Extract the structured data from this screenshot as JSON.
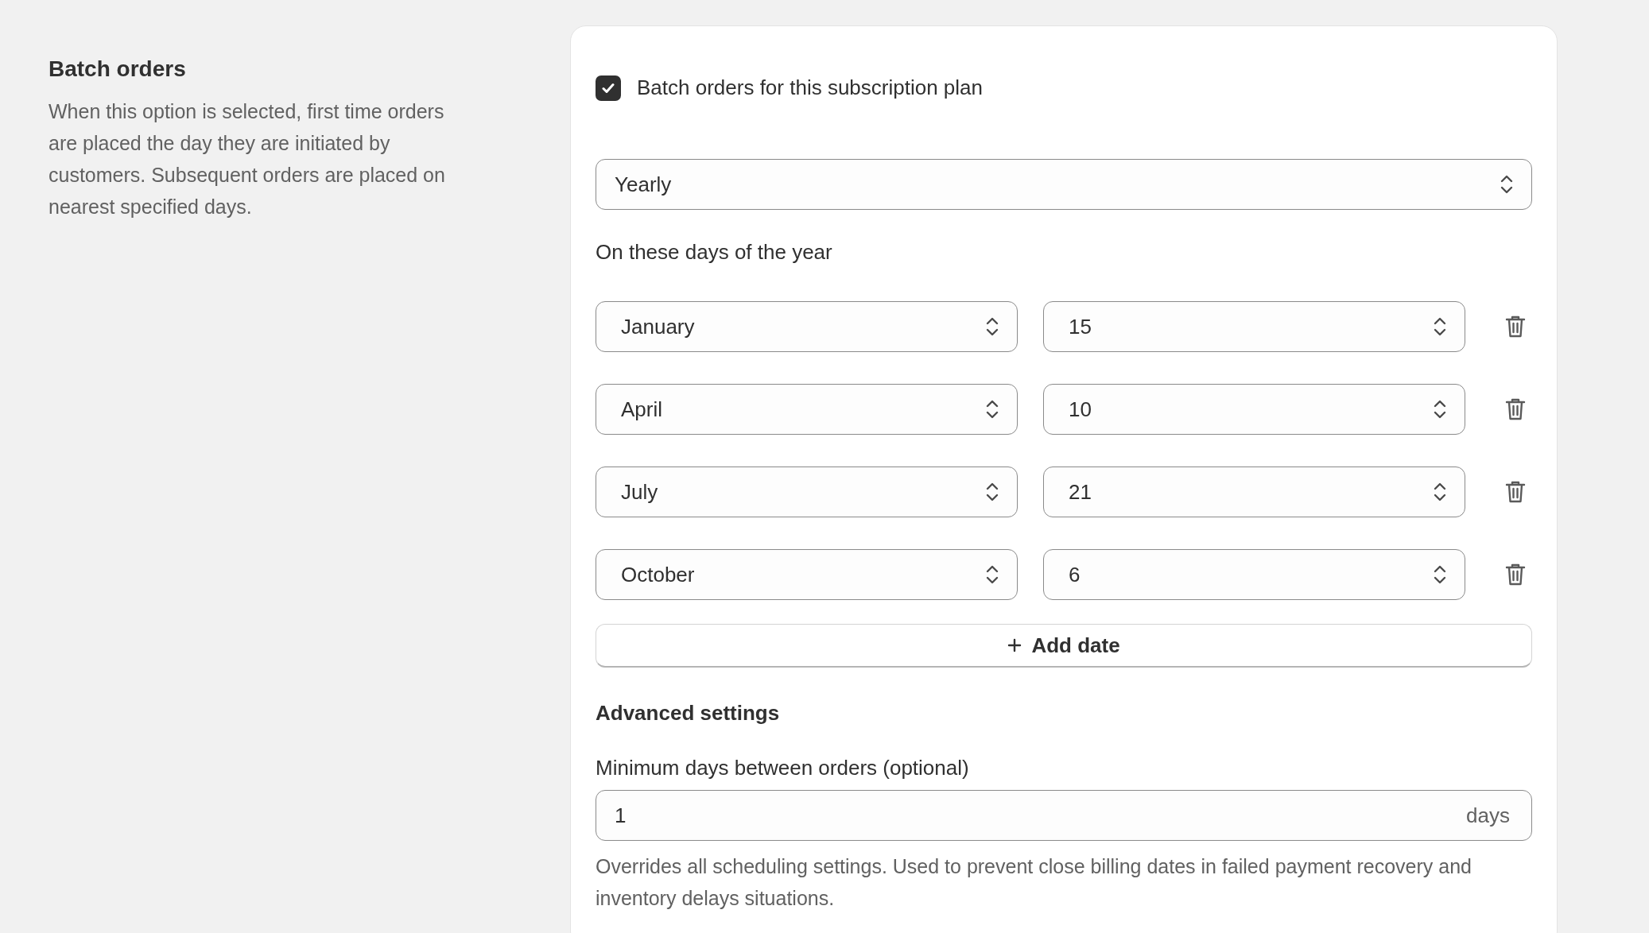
{
  "section": {
    "title": "Batch orders",
    "description": "When this option is selected, first time orders are placed the day they are initiated by customers. Subsequent orders are placed on nearest specified days."
  },
  "batch_checkbox": {
    "label": "Batch orders for this subscription plan",
    "checked": true
  },
  "frequency": {
    "value": "Yearly"
  },
  "days_label": "On these days of the year",
  "dates": [
    {
      "month": "January",
      "day": "15"
    },
    {
      "month": "April",
      "day": "10"
    },
    {
      "month": "July",
      "day": "21"
    },
    {
      "month": "October",
      "day": "6"
    }
  ],
  "add_button": {
    "label": "Add date"
  },
  "advanced": {
    "title": "Advanced settings",
    "min_days": {
      "label": "Minimum days between orders (optional)",
      "value": "1",
      "suffix": "days",
      "help": "Overrides all scheduling settings. Used to prevent close billing dates in failed payment recovery and inventory delays situations."
    }
  }
}
